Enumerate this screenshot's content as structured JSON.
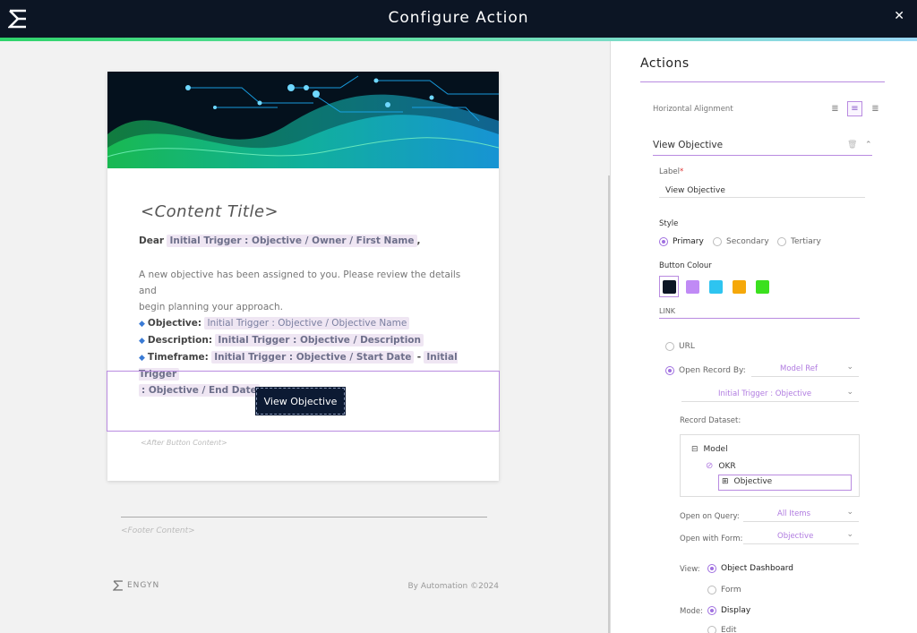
{
  "header": {
    "title": "Configure Action",
    "close_icon": "close-icon",
    "logo_icon": "sigma-logo-icon"
  },
  "email": {
    "content_title": "<Content Title>",
    "dear": "Dear",
    "owner_chip": "Initial Trigger : Objective / Owner / First Name",
    "comma": ",",
    "intro_line1": "A new objective has been assigned to you. Please review the details and",
    "intro_line2": "begin planning your approach.",
    "objective_label": "Objective:",
    "objective_chip": "Initial Trigger : Objective / Objective Name",
    "description_label": "Description:",
    "description_chip": "Initial Trigger : Objective / Description",
    "timeframe_label": "Timeframe:",
    "start_chip": "Initial Trigger : Objective / Start Date",
    "dash": "-",
    "end_chip_a": "Initial Trigger",
    "end_chip_b": ": Objective / End Date",
    "button_label": "View Objective",
    "after_button": "<After Button Content>",
    "footer_content": "<Footer Content>",
    "brand": "ENGYN",
    "by_line": "By Automation ©2024"
  },
  "panel": {
    "title": "Actions",
    "horizontal_alignment": "Horizontal Alignment",
    "section_title": "View Objective",
    "label_caption": "Label",
    "label_required": "*",
    "label_value": "View Objective",
    "style_caption": "Style",
    "style_options": [
      "Primary",
      "Secondary",
      "Tertiary"
    ],
    "style_selected": "Primary",
    "button_colour_caption": "Button Colour",
    "colours": [
      "#0c1524",
      "#c08af5",
      "#2ec4f0",
      "#f5a80a",
      "#3be01e"
    ],
    "link_caption": "LINK",
    "url_option": "URL",
    "open_record_label": "Open Record By:",
    "open_record_value": "Model Ref",
    "trigger_value": "Initial Trigger : Objective",
    "record_dataset_label": "Record Dataset:",
    "tree": {
      "model": "Model",
      "okr": "OKR",
      "objective": "Objective"
    },
    "open_query_label": "Open on Query:",
    "open_query_value": "All Items",
    "open_form_label": "Open with Form:",
    "open_form_value": "Objective",
    "view_label": "View:",
    "view_options": [
      "Object Dashboard",
      "Form"
    ],
    "mode_label": "Mode:",
    "mode_options": [
      "Display",
      "Edit"
    ]
  }
}
